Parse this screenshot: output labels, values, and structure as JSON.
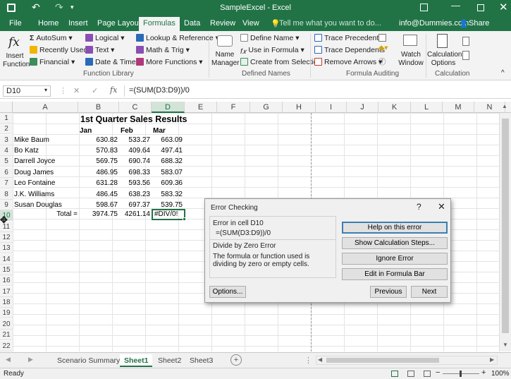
{
  "app": {
    "title": "SampleExcel - Excel",
    "user": "info@Dummies.com",
    "share_label": "Share",
    "tell_me": "Tell me what you want to do..."
  },
  "colors": {
    "accent": "#217346",
    "selection": "#217346"
  },
  "tabs": [
    "File",
    "Home",
    "Insert",
    "Page Layout",
    "Formulas",
    "Data",
    "Review",
    "View"
  ],
  "ribbon": {
    "function_library": {
      "insert_function": "Insert Function",
      "autosum": "AutoSum",
      "recently_used": "Recently Used",
      "financial": "Financial",
      "logical": "Logical",
      "text": "Text",
      "date_time": "Date & Time",
      "lookup_reference": "Lookup & Reference",
      "math_trig": "Math & Trig",
      "more_functions": "More Functions",
      "group_label": "Function Library"
    },
    "defined_names": {
      "name_manager": "Name Manager",
      "define_name": "Define Name",
      "use_in_formula": "Use in Formula",
      "create_from_selection": "Create from Selection",
      "group_label": "Defined Names"
    },
    "formula_auditing": {
      "trace_precedents": "Trace Precedents",
      "trace_dependents": "Trace Dependents",
      "remove_arrows": "Remove Arrows",
      "watch_window": "Watch Window",
      "group_label": "Formula Auditing"
    },
    "calculation": {
      "calculation_options": "Calculation Options",
      "group_label": "Calculation"
    }
  },
  "formula_bar": {
    "name_box": "D10",
    "formula": "=(SUM(D3:D9))/0"
  },
  "columns": [
    "A",
    "B",
    "C",
    "D",
    "E",
    "F",
    "G",
    "H",
    "I",
    "J",
    "K",
    "L",
    "M",
    "N"
  ],
  "sheet": {
    "title": "1st Quarter Sales Results",
    "headers": [
      "Jan",
      "Feb",
      "Mar"
    ],
    "rows": [
      {
        "name": "Mike Baum",
        "jan": "630.82",
        "feb": "533.27",
        "mar": "663.09"
      },
      {
        "name": "Bo Katz",
        "jan": "570.83",
        "feb": "409.64",
        "mar": "497.41"
      },
      {
        "name": "Darrell Joyce",
        "jan": "569.75",
        "feb": "690.74",
        "mar": "688.32"
      },
      {
        "name": "Doug James",
        "jan": "486.95",
        "feb": "698.33",
        "mar": "583.07"
      },
      {
        "name": "Leo Fontaine",
        "jan": "631.28",
        "feb": "593.56",
        "mar": "609.36"
      },
      {
        "name": "J.K. Williams",
        "jan": "486.45",
        "feb": "638.23",
        "mar": "583.32"
      },
      {
        "name": "Susan Douglas",
        "jan": "598.67",
        "feb": "697.37",
        "mar": "539.75"
      }
    ],
    "total": {
      "label": "Total =",
      "jan": "3974.75",
      "feb": "4261.14",
      "mar": "#DIV/0!"
    }
  },
  "dialog": {
    "title": "Error Checking",
    "help_glyph": "?",
    "error_in_cell": "Error in cell D10",
    "formula": "=(SUM(D3:D9))/0",
    "error_type": "Divide by Zero Error",
    "description": "The formula or function used is dividing by zero or empty cells.",
    "buttons": {
      "help": "Help on this error",
      "show_steps": "Show Calculation Steps...",
      "ignore": "Ignore Error",
      "edit": "Edit in Formula Bar",
      "options": "Options...",
      "previous": "Previous",
      "next": "Next"
    }
  },
  "sheet_tabs": [
    "Scenario Summary",
    "Sheet1",
    "Sheet2",
    "Sheet3"
  ],
  "status": {
    "ready": "Ready",
    "zoom": "100%"
  }
}
